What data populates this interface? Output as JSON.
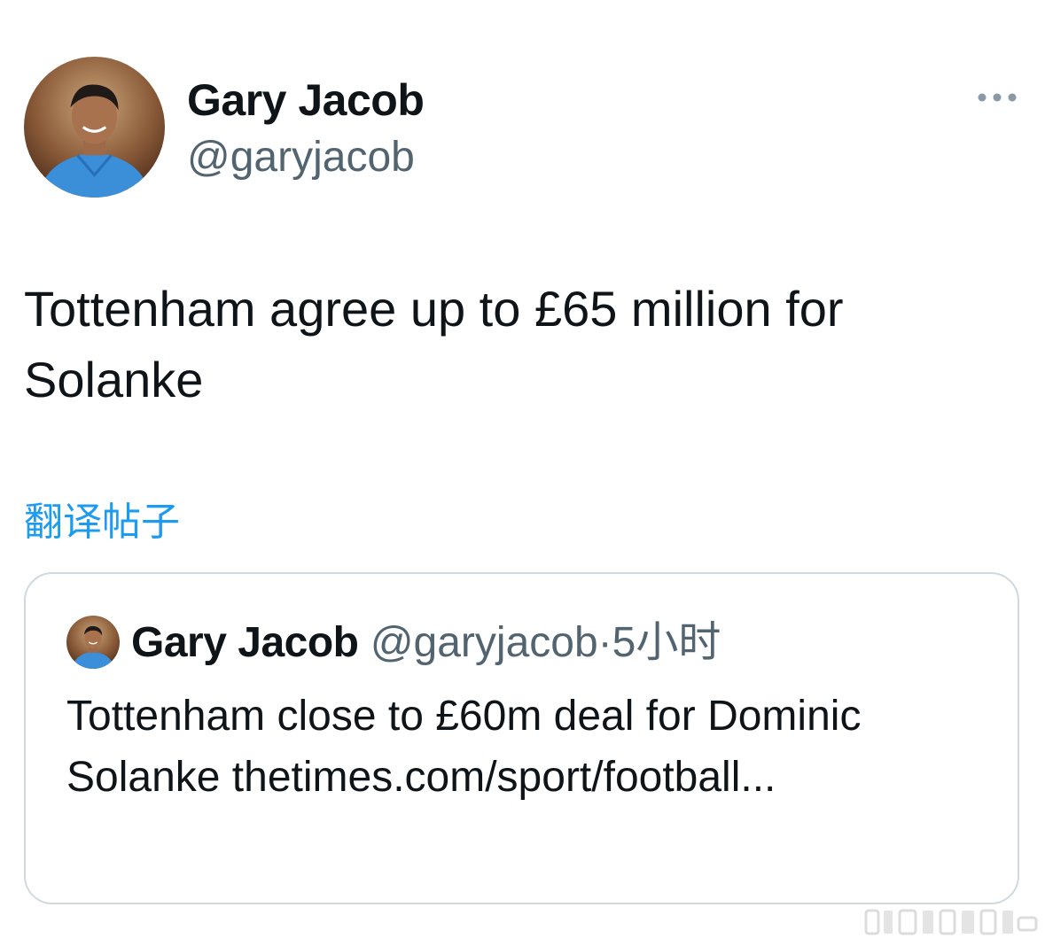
{
  "tweet": {
    "author": {
      "display_name": "Gary Jacob",
      "handle": "@garyjacob"
    },
    "text": "Tottenham agree up to £65 million for Solanke",
    "translate_label": "翻译帖子",
    "more_icon": "more-horizontal-icon"
  },
  "quote": {
    "author": {
      "display_name": "Gary Jacob",
      "handle": "@garyjacob"
    },
    "separator": "·",
    "time": "5小时",
    "text": "Tottenham close to £60m deal for Dominic Solanke thetimes.com/sport/football..."
  },
  "colors": {
    "text_primary": "#0f1419",
    "text_secondary": "#536471",
    "link": "#1d9bf0",
    "border": "#cfd9de"
  }
}
